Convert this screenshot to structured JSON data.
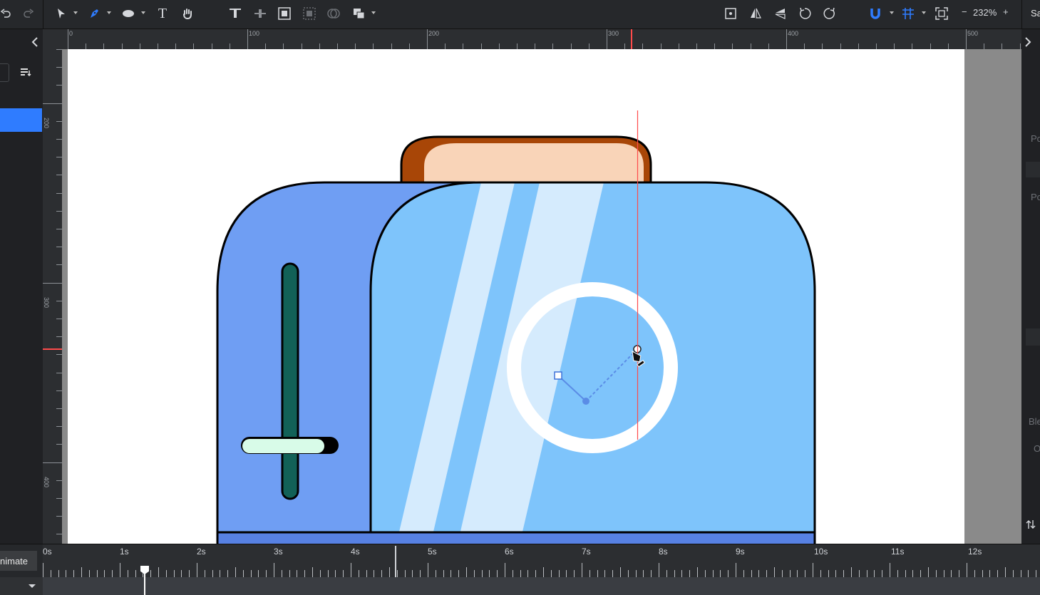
{
  "toolbar": {
    "zoom": "232%",
    "zoom_minus": "−",
    "zoom_plus": "+",
    "text_tool_glyph": "T",
    "save_stub": "Sa"
  },
  "ruler": {
    "top_labels": [
      "0",
      "100",
      "200",
      "300",
      "400",
      "500"
    ],
    "left_labels": [
      "200",
      "300",
      "400"
    ]
  },
  "right_panel": {
    "stubs": [
      "Pc",
      "Pc",
      "Ble",
      "O"
    ]
  },
  "timeline": {
    "animate_label": "nimate",
    "time_labels": [
      "0s",
      "1s",
      "2s",
      "3s",
      "4s",
      "5s",
      "6s",
      "7s",
      "8s",
      "9s",
      "10s",
      "11s",
      "12s"
    ],
    "playhead_seconds": 1.3
  },
  "colors": {
    "toaster_body": "#6f9ef3",
    "toaster_front": "#7ec4fb",
    "toast": "#f9d4b8",
    "toast_crust": "#a84607",
    "lever": "#126157",
    "handle": "#d8fbe8",
    "accent": "#2f7cff",
    "guide": "#ff4b4b"
  }
}
